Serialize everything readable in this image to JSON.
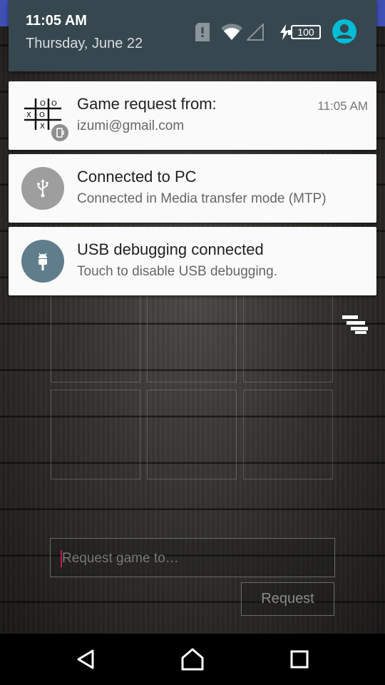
{
  "status": {
    "time": "11:05 AM",
    "date": "Thursday, June 22",
    "battery_level": "100"
  },
  "notifications": [
    {
      "title": "Game request from:",
      "subtitle": "izumi@gmail.com",
      "time": "11:05 AM",
      "icon": "tic-tac-toe-icon"
    },
    {
      "title": "Connected to PC",
      "subtitle": "Connected in Media transfer mode (MTP)",
      "icon": "usb-icon",
      "icon_color": "#9e9e9e"
    },
    {
      "title": "USB debugging connected",
      "subtitle": "Touch to disable USB debugging.",
      "icon": "android-bug-icon",
      "icon_color": "#607d8b"
    }
  ],
  "app": {
    "input_placeholder": "Request game to…",
    "request_label": "Request"
  },
  "colors": {
    "header": "#37474f",
    "accent": "#3f51b5",
    "avatar": "#00bcd4"
  }
}
